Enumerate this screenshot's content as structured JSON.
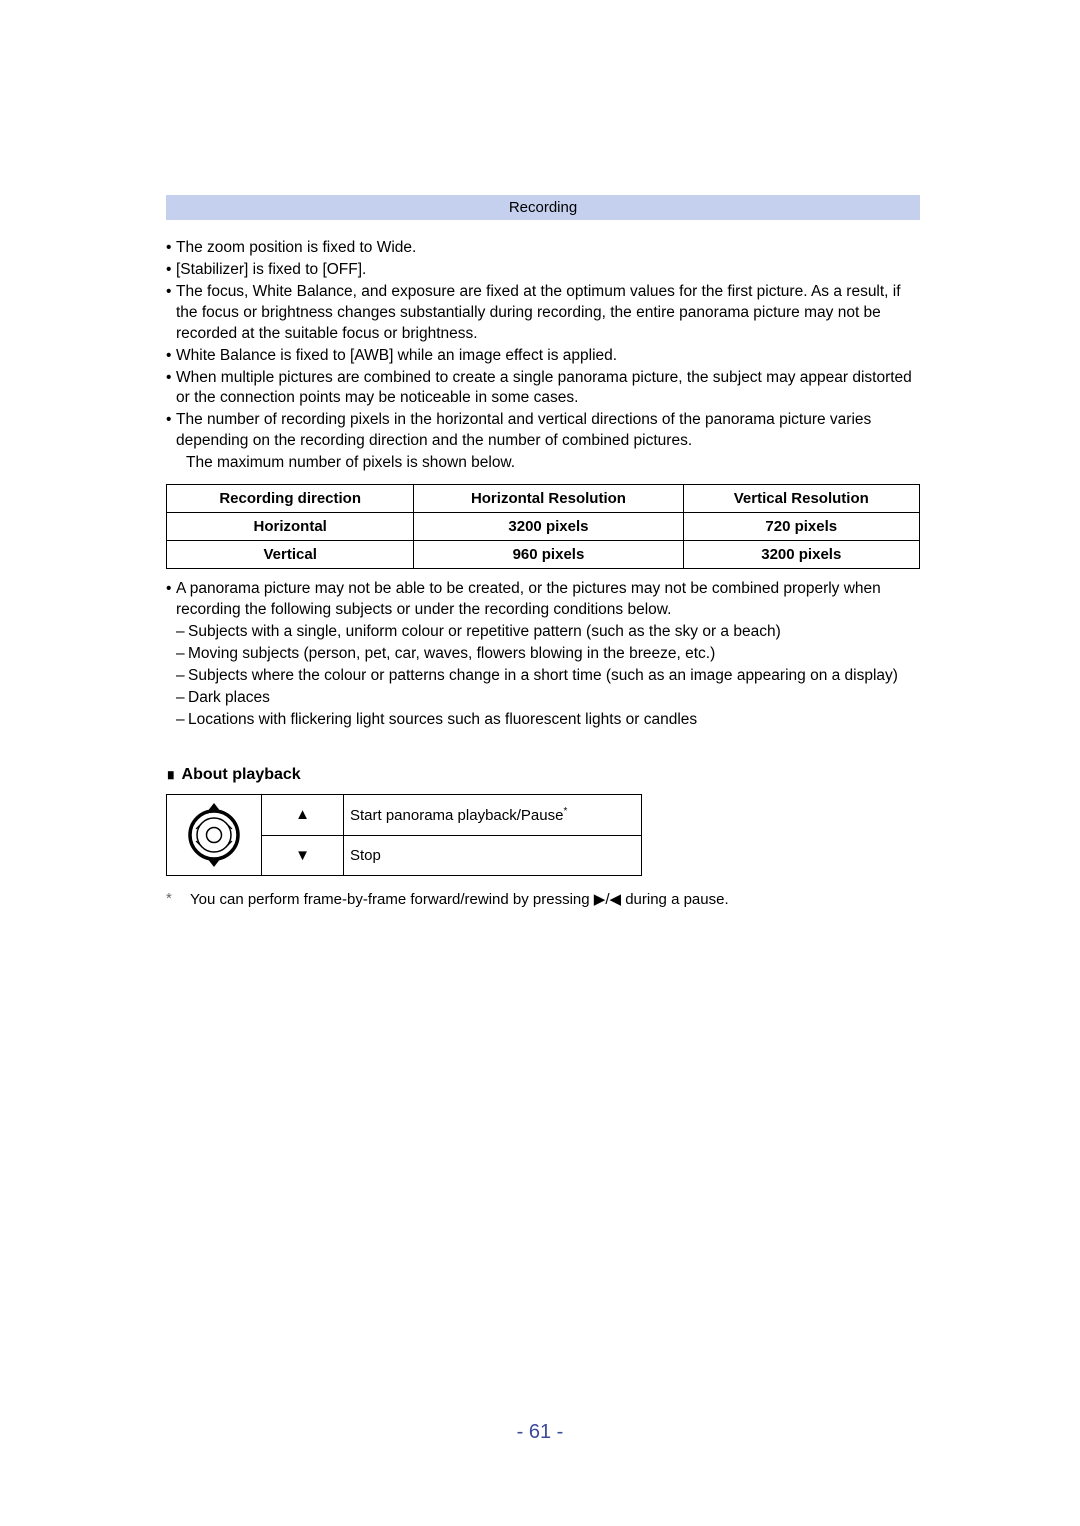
{
  "header": {
    "title": "Recording"
  },
  "bullets_top": [
    "The zoom position is fixed to Wide.",
    "[Stabilizer] is fixed to [OFF].",
    "The focus, White Balance, and exposure are fixed at the optimum values for the first picture. As a result, if the focus or brightness changes substantially during recording, the entire panorama picture may not be recorded at the suitable focus or brightness.",
    "White Balance is fixed to [AWB] while an image effect is applied.",
    "When multiple pictures are combined to create a single panorama picture, the subject may appear distorted or the connection points may be noticeable in some cases.",
    "The number of recording pixels in the horizontal and vertical directions of the panorama picture varies depending on the recording direction and the number of combined pictures."
  ],
  "bullets_top_tail": "The maximum number of pixels is shown below.",
  "chart_data": {
    "type": "table",
    "headers": [
      "Recording direction",
      "Horizontal Resolution",
      "Vertical Resolution"
    ],
    "rows": [
      [
        "Horizontal",
        "3200 pixels",
        "720 pixels"
      ],
      [
        "Vertical",
        "960 pixels",
        "3200 pixels"
      ]
    ]
  },
  "bullets_bottom": {
    "intro": "A panorama picture may not be able to be created, or the pictures may not be combined properly when recording the following subjects or under the recording conditions below.",
    "subs": [
      "Subjects with a single, uniform colour or repetitive pattern (such as the sky or a beach)",
      "Moving subjects (person, pet, car, waves, flowers blowing in the breeze, etc.)",
      "Subjects where the colour or patterns change in a short time (such as an image appearing on a display)",
      "Dark places",
      "Locations with flickering light sources such as fluorescent lights or candles"
    ]
  },
  "playback": {
    "heading": "About playback",
    "up_symbol": "▲",
    "down_symbol": "▼",
    "up_desc": "Start panorama playback/Pause",
    "up_sup": "*",
    "down_desc": "Stop"
  },
  "footnote": {
    "marker": "*",
    "text_before": "You can perform frame-by-frame forward/rewind by pressing ",
    "symbols": "▶/◀",
    "text_after": " during a pause."
  },
  "page_number": "- 61 -"
}
